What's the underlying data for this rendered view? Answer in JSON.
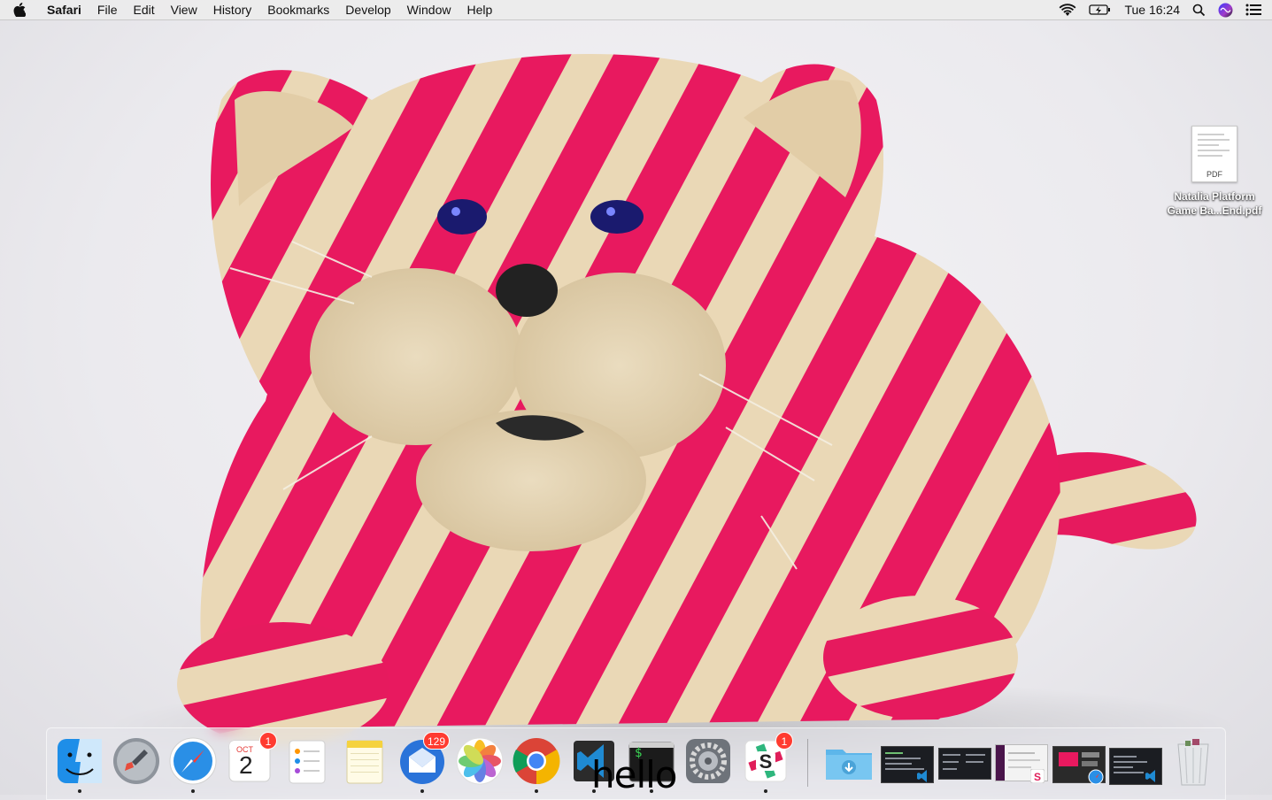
{
  "menubar": {
    "app_name": "Safari",
    "items": [
      "File",
      "Edit",
      "View",
      "History",
      "Bookmarks",
      "Develop",
      "Window",
      "Help"
    ],
    "clock": "Tue 16:24"
  },
  "desktop": {
    "file": {
      "type_label": "PDF",
      "name_line1": "Natalia Platform",
      "name_line2": "Game Ba...End.pdf"
    }
  },
  "dock": {
    "calendar_month": "OCT",
    "calendar_day": "2",
    "calendar_badge": "1",
    "mail_badge": "129",
    "slack_badge": "1",
    "overlay_text": "hello",
    "terminal_prompt": "$"
  },
  "colors": {
    "cat_pink": "#e8195f",
    "cat_cream": "#e9d9b8",
    "badge_red": "#ff3b30"
  }
}
